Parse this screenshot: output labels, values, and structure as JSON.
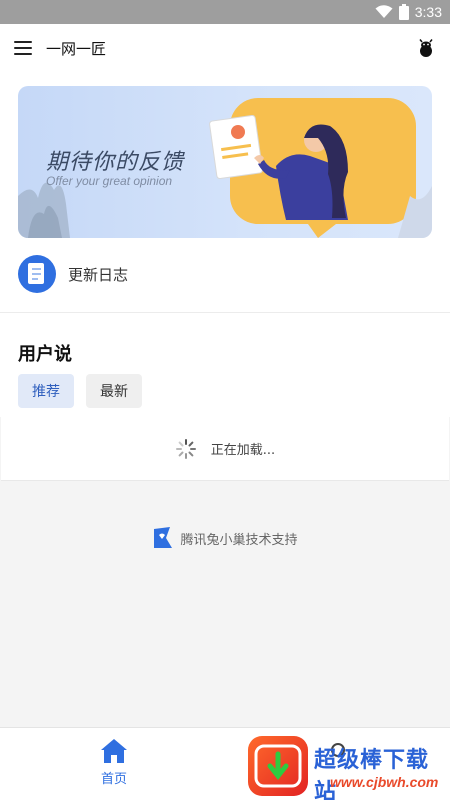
{
  "status_bar": {
    "time": "3:33"
  },
  "app_bar": {
    "title": "一网一匠"
  },
  "banner": {
    "title": "期待你的反馈",
    "subtitle": "Offer your great opinion"
  },
  "changelog": {
    "label": "更新日志"
  },
  "feedback": {
    "section_title": "用户说",
    "tabs": [
      {
        "label": "推荐",
        "active": true
      },
      {
        "label": "最新",
        "active": false
      }
    ]
  },
  "loading": {
    "text": "正在加载..."
  },
  "support": {
    "text": "腾讯兔小巢技术支持"
  },
  "bottom_nav": {
    "home_label": "首页"
  },
  "watermark": {
    "text": "超级棒下载站",
    "url": "www.cjbwh.com"
  },
  "colors": {
    "accent": "#2f6fe0",
    "status_bar": "#9e9e9e",
    "background": "#f4f4f4"
  }
}
